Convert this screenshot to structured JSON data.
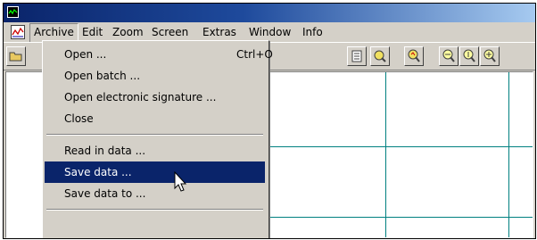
{
  "menubar": {
    "items": [
      {
        "label": "Archive"
      },
      {
        "label": "Edit"
      },
      {
        "label": "Zoom"
      },
      {
        "label": "Screen"
      },
      {
        "label": "Extras"
      },
      {
        "label": "Window"
      },
      {
        "label": "Info"
      }
    ],
    "active": "Archive"
  },
  "archive_menu": {
    "items": [
      {
        "label": "Open ...",
        "shortcut": "Ctrl+O"
      },
      {
        "label": "Open batch ..."
      },
      {
        "label": "Open electronic signature ..."
      },
      {
        "label": "Close"
      },
      {
        "label": "Read in data ..."
      },
      {
        "label": "Save data ...",
        "highlighted": true
      },
      {
        "label": "Save data to ..."
      }
    ]
  },
  "colors": {
    "title_bar": "#0a246a",
    "highlight": "#0a246a",
    "grid": "#008080",
    "chrome": "#d4d0c8"
  },
  "icons": [
    "app-icon",
    "chart-icon",
    "open-folder-icon",
    "list-icon",
    "tool-icon",
    "zoom-icon",
    "zoom-out-icon",
    "zoom-in-icon",
    "zoom-fit-icon",
    "mouse-cursor-icon"
  ]
}
